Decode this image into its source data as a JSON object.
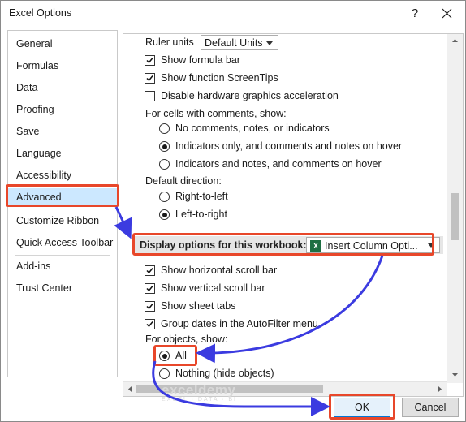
{
  "window": {
    "title": "Excel Options",
    "help_glyph": "?",
    "close_icon": "close-icon"
  },
  "nav": {
    "items": [
      "General",
      "Formulas",
      "Data",
      "Proofing",
      "Save",
      "Language",
      "Accessibility",
      "Advanced",
      "Customize Ribbon",
      "Quick Access Toolbar",
      "Add-ins",
      "Trust Center"
    ],
    "selected": "Advanced"
  },
  "content": {
    "ruler_units_label": "Ruler units",
    "ruler_units_value": "Default Units",
    "show_formula_bar": "Show formula bar",
    "show_function_screentips": "Show function ScreenTips",
    "disable_hw_accel": "Disable hardware graphics acceleration",
    "comments_heading": "For cells with comments, show:",
    "comments_options": [
      "No comments, notes, or indicators",
      "Indicators only, and comments and notes on hover",
      "Indicators and notes, and comments on hover"
    ],
    "default_direction_heading": "Default direction:",
    "direction_options": [
      "Right-to-left",
      "Left-to-right"
    ],
    "workbook_section_label": "Display options for this workbook:",
    "workbook_value": "Insert Column Opti...",
    "show_hscroll": "Show horizontal scroll bar",
    "show_vscroll": "Show vertical scroll bar",
    "show_sheet_tabs": "Show sheet tabs",
    "group_dates": "Group dates in the AutoFilter menu",
    "objects_heading": "For objects, show:",
    "objects_options": [
      "All",
      "Nothing (hide objects)"
    ]
  },
  "buttons": {
    "ok": "OK",
    "cancel": "Cancel"
  },
  "watermark": {
    "brand": "exceldemy",
    "tagline": "EXCEL · DATA · BI"
  },
  "colors": {
    "annotation_red": "#e8472a",
    "annotation_blue": "#3b3be0",
    "selected_nav": "#cce8ff",
    "excel_green": "#1d6f42"
  }
}
